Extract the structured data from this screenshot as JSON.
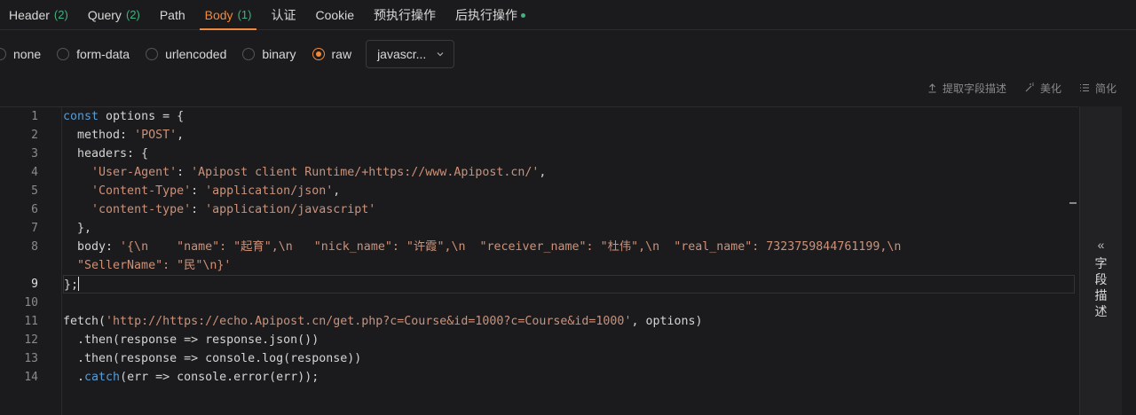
{
  "tabs": [
    {
      "label": "Header",
      "count": "(2)"
    },
    {
      "label": "Query",
      "count": "(2)"
    },
    {
      "label": "Path",
      "count": ""
    },
    {
      "label": "Body",
      "count": "(1)"
    },
    {
      "label": "认证",
      "count": ""
    },
    {
      "label": "Cookie",
      "count": ""
    },
    {
      "label": "预执行操作",
      "count": ""
    },
    {
      "label": "后执行操作",
      "count": ""
    }
  ],
  "body_types": [
    "none",
    "form-data",
    "urlencoded",
    "binary",
    "raw"
  ],
  "selected_body_type": "raw",
  "raw_language": "javascr...",
  "toolbar": {
    "extract": "提取字段描述",
    "beautify": "美化",
    "simplify": "简化"
  },
  "side_panel": {
    "arrows": "«",
    "chars": [
      "字",
      "段",
      "描",
      "述"
    ]
  },
  "editor": {
    "line_numbers": [
      "1",
      "2",
      "3",
      "4",
      "5",
      "6",
      "7",
      "8",
      "",
      "9",
      "10",
      "11",
      "12",
      "13",
      "14"
    ],
    "current_line": "9"
  }
}
